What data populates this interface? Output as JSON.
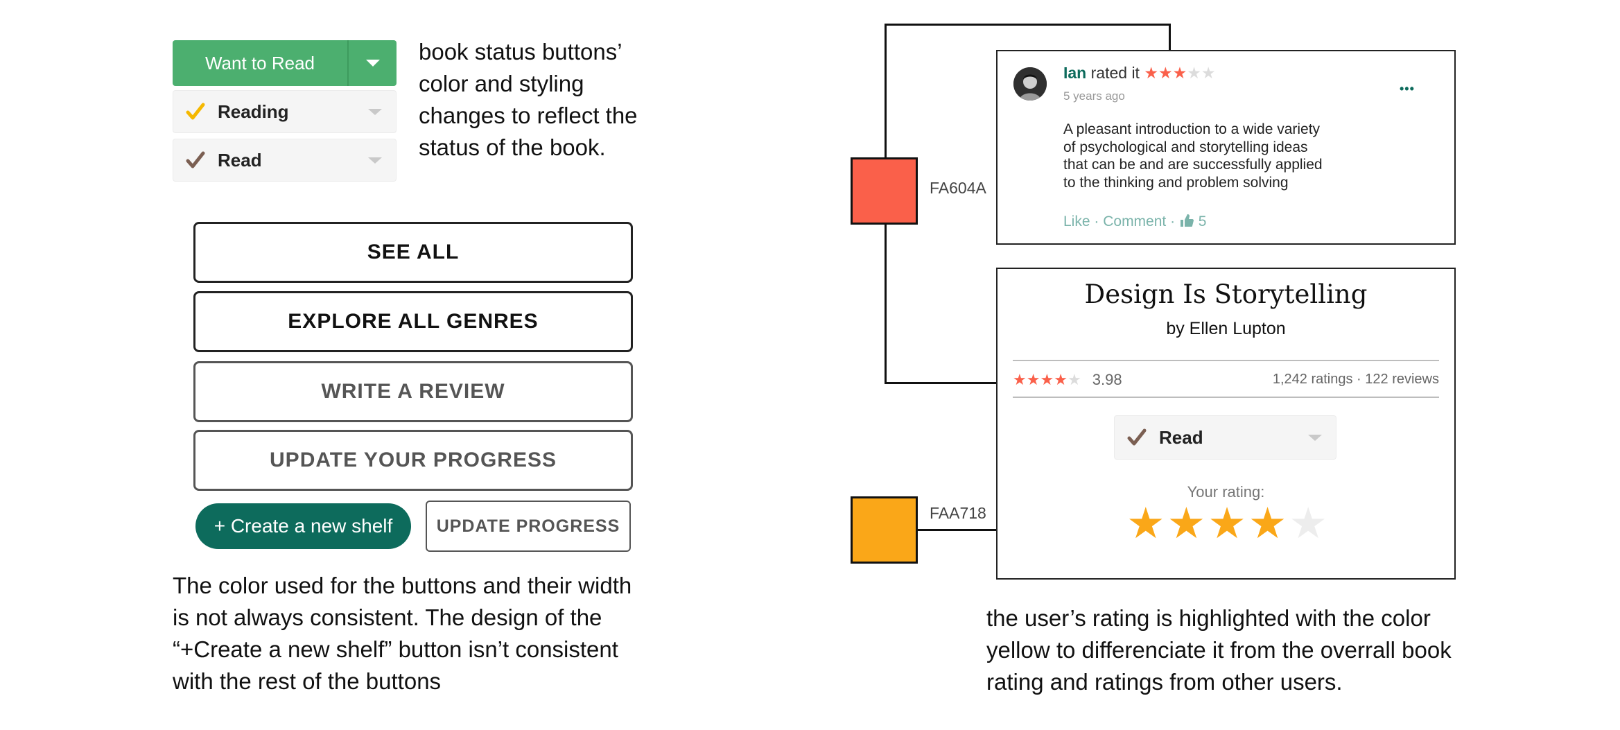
{
  "status_buttons": {
    "want": "Want to Read",
    "reading": "Reading",
    "read": "Read"
  },
  "notes": {
    "status_note": [
      "book status buttons’",
      "color and styling",
      "changes to reflect the",
      "status of the book."
    ],
    "buttons_note": [
      "The color used for the buttons and their width",
      "is not always consistent. The design of the",
      "“+Create a new shelf” button isn’t consistent",
      "with the rest of the buttons"
    ],
    "rating_note": [
      "the user’s rating is highlighted with the color",
      "yellow to differenciate it from the overrall book",
      "rating and ratings from other users."
    ]
  },
  "buttons": {
    "see_all": "SEE ALL",
    "explore": "EXPLORE ALL GENRES",
    "write_review": "WRITE A REVIEW",
    "update_your_progress": "UPDATE YOUR PROGRESS",
    "create_shelf": "+ Create a new shelf",
    "update_progress": "UPDATE PROGRESS"
  },
  "review": {
    "user": "Ian",
    "rated_text": "rated it",
    "stars_filled": 3,
    "stars_total": 5,
    "time": "5 years ago",
    "more": "•••",
    "body": [
      "A pleasant introduction to a wide variety",
      "of psychological and storytelling ideas",
      "that can be and are successfully applied",
      "to the thinking and problem solving"
    ],
    "like": "Like",
    "sep": "·",
    "comment": "Comment",
    "likes_count": "5"
  },
  "book": {
    "title": "Design Is Storytelling",
    "author": "by Ellen Lupton",
    "avg_rating": "3.98",
    "stars_filled": 4,
    "counts": "1,242 ratings · 122 reviews",
    "shelf": "Read",
    "your_rating_label": "Your rating:",
    "user_rating": 4
  },
  "swatches": {
    "red_hex": "FA604A",
    "orange_hex": "FAA718"
  },
  "colors": {
    "red": "#FA604A",
    "orange": "#FAA718",
    "green": "#4caf6f",
    "teal": "#0d6b5c",
    "reading_check": "#f5b800",
    "read_check": "#7b5f52"
  }
}
